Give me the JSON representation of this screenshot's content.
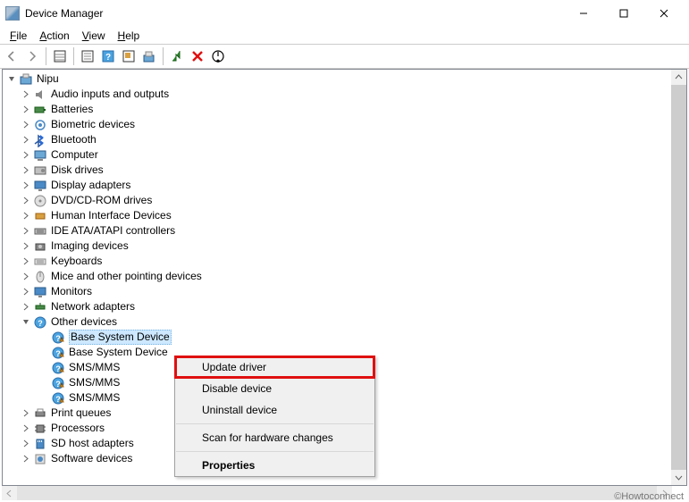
{
  "window": {
    "title": "Device Manager"
  },
  "menu": {
    "file": "File",
    "action": "Action",
    "view": "View",
    "help": "Help"
  },
  "tree": {
    "root": "Nipu",
    "categories": [
      {
        "label": "Audio inputs and outputs",
        "icon": "audio"
      },
      {
        "label": "Batteries",
        "icon": "battery"
      },
      {
        "label": "Biometric devices",
        "icon": "biometric"
      },
      {
        "label": "Bluetooth",
        "icon": "bluetooth"
      },
      {
        "label": "Computer",
        "icon": "computer"
      },
      {
        "label": "Disk drives",
        "icon": "disk"
      },
      {
        "label": "Display adapters",
        "icon": "display"
      },
      {
        "label": "DVD/CD-ROM drives",
        "icon": "dvd"
      },
      {
        "label": "Human Interface Devices",
        "icon": "hid"
      },
      {
        "label": "IDE ATA/ATAPI controllers",
        "icon": "ide"
      },
      {
        "label": "Imaging devices",
        "icon": "imaging"
      },
      {
        "label": "Keyboards",
        "icon": "keyboard"
      },
      {
        "label": "Mice and other pointing devices",
        "icon": "mouse"
      },
      {
        "label": "Monitors",
        "icon": "monitor"
      },
      {
        "label": "Network adapters",
        "icon": "network"
      }
    ],
    "other_devices": {
      "label": "Other devices",
      "children": [
        {
          "label": "Base System Device",
          "selected": true
        },
        {
          "label": "Base System Device",
          "selected": false
        },
        {
          "label": "SMS/MMS",
          "selected": false
        },
        {
          "label": "SMS/MMS",
          "selected": false
        },
        {
          "label": "SMS/MMS",
          "selected": false
        }
      ]
    },
    "categories_after": [
      {
        "label": "Print queues",
        "icon": "printer"
      },
      {
        "label": "Processors",
        "icon": "cpu"
      },
      {
        "label": "SD host adapters",
        "icon": "sd"
      },
      {
        "label": "Software devices",
        "icon": "software"
      }
    ]
  },
  "context_menu": {
    "update": "Update driver",
    "disable": "Disable device",
    "uninstall": "Uninstall device",
    "scan": "Scan for hardware changes",
    "properties": "Properties"
  },
  "watermark": "©Howtoconnect"
}
